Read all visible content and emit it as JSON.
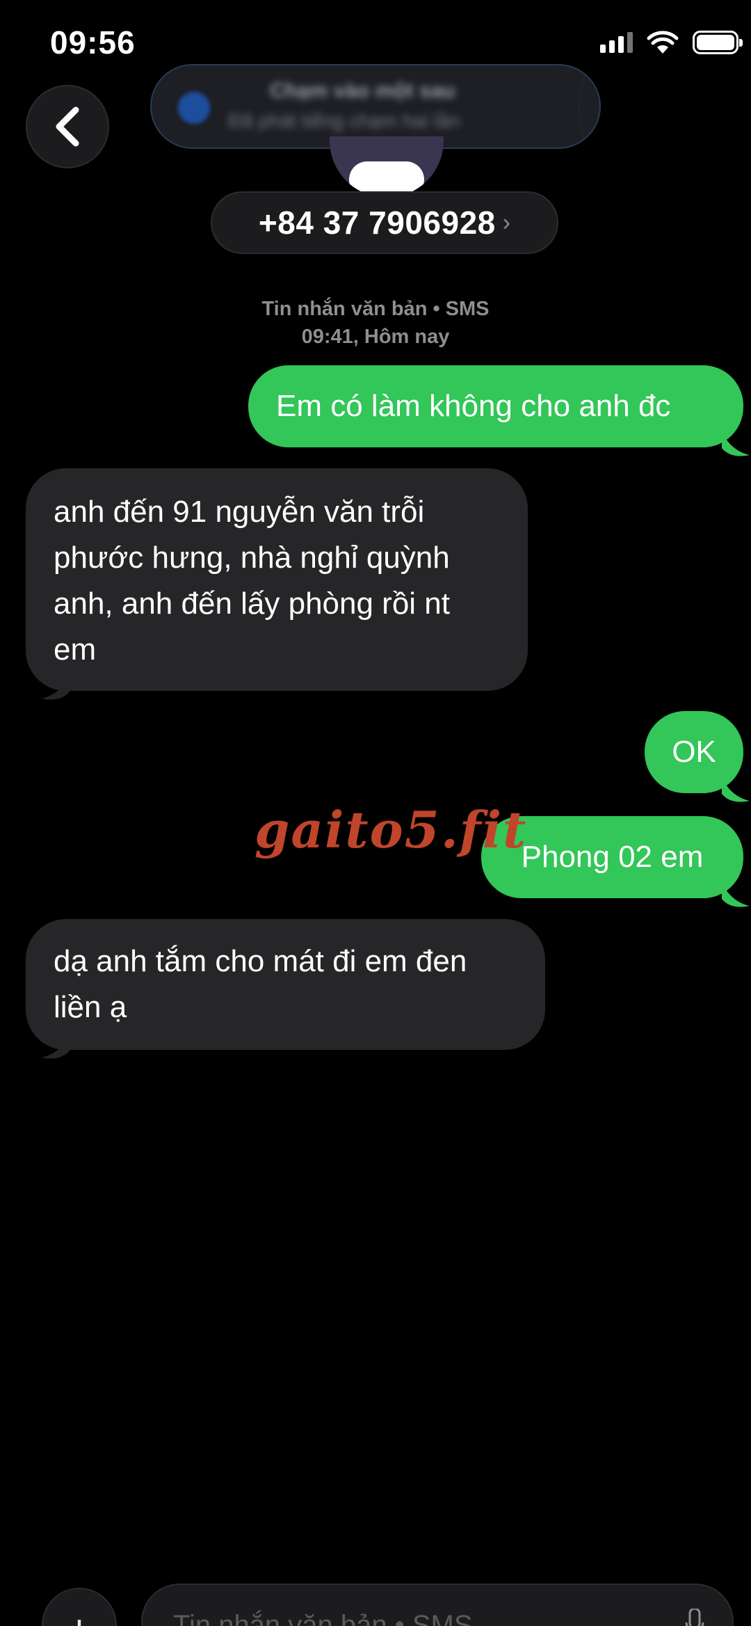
{
  "status": {
    "time": "09:56"
  },
  "notification": {
    "title": "Chạm vào một sau",
    "subtitle": "Đã phát tiếng chạm hai lần"
  },
  "contact": {
    "name": "+84 37 7906928",
    "chevron": "›"
  },
  "thread": {
    "meta_line1": "Tin nhắn văn bản • SMS",
    "meta_line2": "09:41, Hôm nay"
  },
  "messages": [
    {
      "direction": "out",
      "text": "Em có làm không cho anh đc"
    },
    {
      "direction": "in",
      "lines": [
        "anh đến 91 nguyễn văn trỗi",
        "phước hưng, nhà nghỉ quỳnh",
        "anh, anh đến lấy phòng rồi nt",
        "em"
      ]
    },
    {
      "direction": "out",
      "text": "OK"
    },
    {
      "direction": "out",
      "text": "Phong 02 em"
    },
    {
      "direction": "in",
      "lines": [
        "dạ anh tắm cho mát đi em đen",
        "liền ạ"
      ]
    }
  ],
  "watermark": "gaito5.fit",
  "composer": {
    "placeholder": "Tin nhắn văn bản • SMS",
    "add_label": "+"
  },
  "colors": {
    "outgoing": "#33c659",
    "incoming": "#262628",
    "background": "#000000"
  },
  "icons": {
    "back": "chevron-left-icon",
    "mic": "microphone-icon",
    "wifi": "wifi-icon",
    "signal": "cellular-signal-icon",
    "battery": "battery-icon"
  }
}
